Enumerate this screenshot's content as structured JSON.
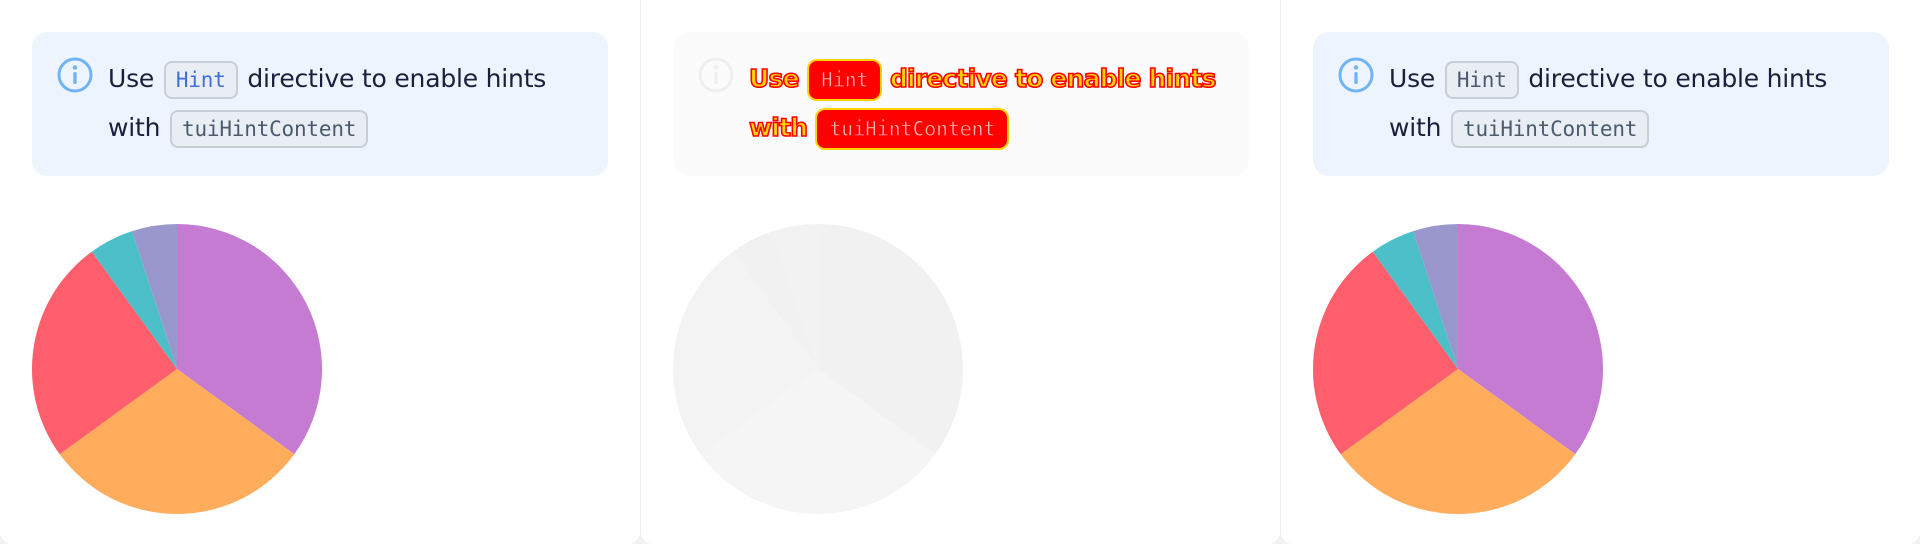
{
  "panels": [
    {
      "notification": {
        "text_use": "Use",
        "code_hint": "Hint",
        "text_directive": "directive to enable hints",
        "text_with": "with",
        "code_content": "tuiHintContent"
      },
      "pie": {
        "values": [
          35,
          30,
          25,
          5,
          5
        ],
        "colors": [
          "#c67bd2",
          "#ffad5c",
          "#ff5f6d",
          "#4dbfc9",
          "#9a97cd"
        ]
      }
    },
    {
      "notification": {
        "text_use": "Use",
        "code_hint": "Hint",
        "text_directive": "directive to enable hints",
        "text_with": "with",
        "code_content": "tuiHintContent"
      },
      "pie": {
        "values": [
          35,
          30,
          25,
          5,
          5
        ],
        "colors": [
          "#f1f1f1",
          "#f5f5f5",
          "#f3f3f3",
          "#f1f1f1",
          "#f2f2f2"
        ]
      }
    },
    {
      "notification": {
        "text_use": "Use",
        "code_hint": "Hint",
        "text_directive": "directive to enable hints",
        "text_with": "with",
        "code_content": "tuiHintContent"
      },
      "pie": {
        "values": [
          35,
          30,
          25,
          5,
          5
        ],
        "colors": [
          "#c67bd2",
          "#ffad5c",
          "#ff5f6d",
          "#4dbfc9",
          "#9a97cd"
        ]
      }
    }
  ],
  "icon": "info-icon",
  "accent_color": "#70b4f5"
}
